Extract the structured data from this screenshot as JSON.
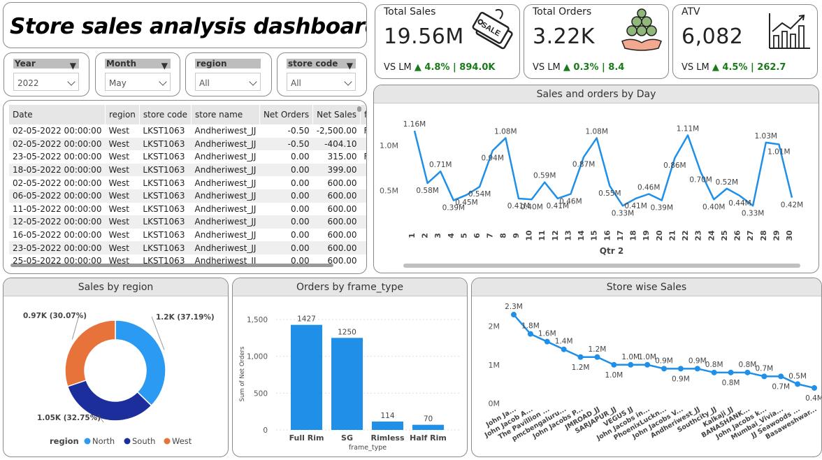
{
  "title": "Store sales analysis dashboard",
  "slicers": [
    {
      "label": "Year",
      "value": "2022"
    },
    {
      "label": "Month",
      "value": "May"
    },
    {
      "label": "region",
      "value": "All"
    },
    {
      "label": "store code",
      "value": "All"
    }
  ],
  "kpis": [
    {
      "title": "Total Sales",
      "value": "19.56M",
      "vs_prefix": "VS LM",
      "delta": "▲ 4.8% | 894.0K",
      "icon": "sale-tag-icon"
    },
    {
      "title": "Total Orders",
      "value": "3.22K",
      "vs_prefix": "VS LM",
      "delta": "▲ 0.3% | 8.4",
      "icon": "coins-hand-icon"
    },
    {
      "title": "ATV",
      "value": "6,082",
      "vs_prefix": "VS LM",
      "delta": "▲ 4.5% | 262.7",
      "icon": "growth-chart-icon"
    }
  ],
  "colors": {
    "accent": "#1f8fe8",
    "positive": "#1a7a1a",
    "north": "#2b9af3",
    "south": "#1c2e9c",
    "west": "#e8733a"
  },
  "table": {
    "headers": [
      "Date",
      "region",
      "store code",
      "store name",
      "Net Orders",
      "Net Sales",
      "frame"
    ],
    "rows": [
      [
        "02-05-2022 00:00:00",
        "West",
        "LKST1063",
        "Andheriwest_JJ",
        "-0.50",
        "-2,500.00",
        "Full Ri"
      ],
      [
        "02-05-2022 00:00:00",
        "West",
        "LKST1063",
        "Andheriwest_JJ",
        "-0.50",
        "-404.10",
        ""
      ],
      [
        "23-05-2022 00:00:00",
        "West",
        "LKST1063",
        "Andheriwest_JJ",
        "0.00",
        "315.00",
        "Full Ri"
      ],
      [
        "18-05-2022 00:00:00",
        "West",
        "LKST1063",
        "Andheriwest_JJ",
        "0.00",
        "399.00",
        ""
      ],
      [
        "02-05-2022 00:00:00",
        "West",
        "LKST1063",
        "Andheriwest_JJ",
        "0.00",
        "600.00",
        ""
      ],
      [
        "06-05-2022 00:00:00",
        "West",
        "LKST1063",
        "Andheriwest_JJ",
        "0.00",
        "600.00",
        ""
      ],
      [
        "11-05-2022 00:00:00",
        "West",
        "LKST1063",
        "Andheriwest_JJ",
        "0.00",
        "600.00",
        ""
      ],
      [
        "12-05-2022 00:00:00",
        "West",
        "LKST1063",
        "Andheriwest_JJ",
        "0.00",
        "600.00",
        ""
      ],
      [
        "16-05-2022 00:00:00",
        "West",
        "LKST1063",
        "Andheriwest_JJ",
        "0.00",
        "600.00",
        ""
      ],
      [
        "23-05-2022 00:00:00",
        "West",
        "LKST1063",
        "Andheriwest_JJ",
        "0.00",
        "600.00",
        ""
      ],
      [
        "25-05-2022 00:00:00",
        "West",
        "LKST1063",
        "Andheriwest_JJ",
        "0.00",
        "600.00",
        ""
      ]
    ]
  },
  "chart_data": [
    {
      "type": "line",
      "title": "Sales and orders by Day",
      "xlabel": "Qtr 2",
      "x": [
        1,
        2,
        3,
        4,
        5,
        6,
        7,
        8,
        9,
        10,
        11,
        12,
        13,
        14,
        15,
        16,
        17,
        18,
        19,
        20,
        21,
        22,
        23,
        24,
        25,
        26,
        27,
        28,
        29,
        30
      ],
      "values": [
        1.16,
        0.58,
        0.71,
        0.39,
        0.45,
        0.54,
        0.94,
        1.08,
        0.41,
        0.4,
        0.59,
        0.41,
        0.46,
        0.87,
        1.08,
        0.55,
        0.33,
        0.41,
        0.46,
        0.39,
        0.86,
        1.11,
        0.7,
        0.4,
        0.52,
        0.44,
        0.33,
        1.03,
        1.01,
        0.42
      ],
      "data_labels": [
        "1.16M",
        "0.58M",
        "0.71M",
        "0.39M",
        "0.45M",
        "0.54M",
        "0.94M",
        "1.08M",
        "0.41M",
        "0.40M",
        "0.59M",
        "0.41M",
        "0.46M",
        "0.87M",
        "1.08M",
        "0.55M",
        "0.33M",
        "0.41M",
        "0.46M",
        "0.39M",
        "0.86M",
        "1.11M",
        "0.70M",
        "0.40M",
        "0.52M",
        "0.44M",
        "0.33M",
        "1.03M",
        "1.01M",
        "0.42M"
      ],
      "yticks": [
        "0.5M",
        "1.0M"
      ],
      "ytick_values": [
        0.5,
        1.0
      ],
      "unit": "M"
    },
    {
      "type": "pie",
      "title": "Sales by region",
      "legend_title": "region",
      "categories": [
        "North",
        "South",
        "West"
      ],
      "values": [
        1.2,
        1.05,
        0.97
      ],
      "labels": [
        "1.2K (37.19%)",
        "1.05K (32.75%)",
        "0.97K (30.07%)"
      ]
    },
    {
      "type": "bar",
      "title": "Orders by frame_type",
      "xlabel": "frame_type",
      "ylabel": "Sum of Net Orders",
      "categories": [
        "Full Rim",
        "SG",
        "Rimless",
        "Half Rim"
      ],
      "values": [
        1427,
        1250,
        114,
        70
      ],
      "data_labels": [
        "1427",
        "1250",
        "114",
        "70"
      ],
      "yticks": [
        "0",
        "500",
        "1,000",
        "1,500"
      ],
      "ylim": [
        0,
        1600
      ]
    },
    {
      "type": "line",
      "title": "Store wise Sales",
      "categories": [
        "John Ja...",
        "John Jacob A...",
        "The Pavillion ...",
        "pmcbengaluru...",
        "John Jacobs P...",
        "JMROAD_JJ",
        "SARJAPUR_JJ",
        "VEGUS JJ",
        "John Jacobs in...",
        "PhoenixLuckn...",
        "John Jacobs V...",
        "Andheriwest_JJ",
        "Southcity_JJ",
        "Kalkaji_JJ",
        "BANASHANK...",
        "John Jacobs k...",
        "Mumbai_Vivia...",
        "JJ Seawoods ...",
        "Basaweshwar..."
      ],
      "values": [
        2.3,
        1.8,
        1.6,
        1.4,
        1.2,
        1.2,
        1.0,
        1.0,
        1.0,
        0.9,
        0.9,
        0.9,
        0.8,
        0.8,
        0.8,
        0.7,
        0.7,
        0.5,
        0.4
      ],
      "data_labels": [
        "2.3M",
        "1.8M",
        "1.6M",
        "1.4M",
        "1.2M",
        "1.2M",
        "1.0M",
        "1.0M",
        "1.0M",
        "0.9M",
        "0.9M",
        "0.9M",
        "0.8M",
        "0.8M",
        "0.8M",
        "0.7M",
        "0.7M",
        "0.5M",
        "0.4M"
      ],
      "yticks": [
        "0M",
        "1M",
        "2M"
      ],
      "ylim": [
        0,
        2.5
      ]
    }
  ]
}
